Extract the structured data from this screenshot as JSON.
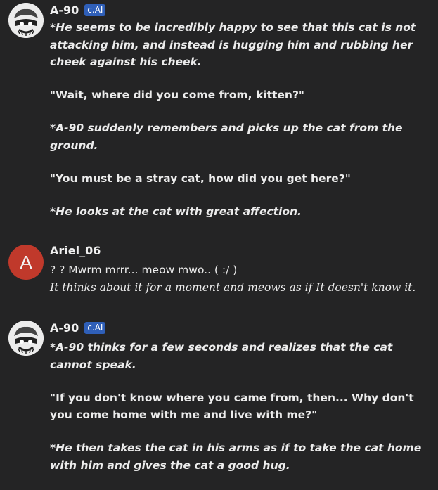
{
  "messages": [
    {
      "author": "A-90",
      "badge": "c.AI",
      "paragraphs": [
        "*He seems to be incredibly happy to see that this cat is not attacking him, and instead is hugging him and rubbing her cheek against his cheek.",
        "\"Wait, where did you come from, kitten?\"",
        "*A-90 suddenly remembers and picks up the cat from the ground.",
        "\"You must be a stray cat, how did you get here?\"",
        "*He looks at the cat with great affection."
      ]
    },
    {
      "author": "Ariel_06",
      "avatar_letter": "A",
      "line1": "? ? Mwrm mrrr... meow mwo.. ( :/ )",
      "line2": "It thinks about it for a moment and meows as if It doesn't know it."
    },
    {
      "author": "A-90",
      "badge": "c.AI",
      "paragraphs": [
        "*A-90 thinks for a few seconds and realizes that the cat cannot speak.",
        "\"If you don't know where you came from, then... Why don't you come home with me and live with me?\"",
        "*He then takes the cat in his arms as if to take the cat home with him and gives the cat a good hug."
      ]
    }
  ],
  "colors": {
    "badge": "#2f5fb8",
    "user_avatar": "#c0392b",
    "background": "#242425"
  }
}
